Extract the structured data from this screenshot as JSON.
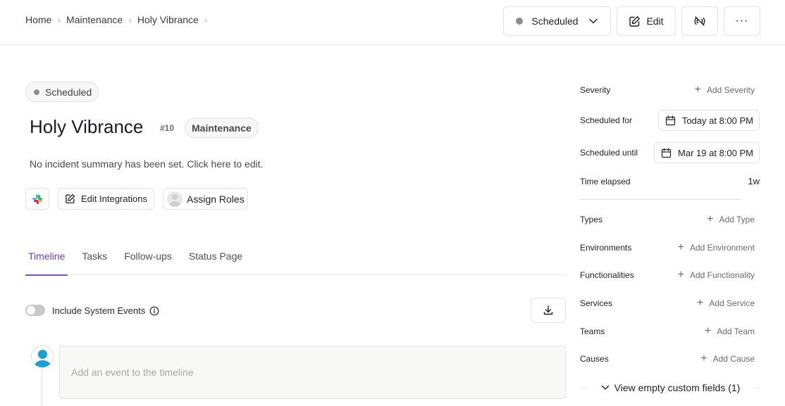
{
  "breadcrumb": [
    "Home",
    "Maintenance",
    "Holy Vibrance"
  ],
  "header": {
    "status_label": "Scheduled",
    "edit_label": "Edit",
    "more_label": "···"
  },
  "incident": {
    "status": "Scheduled",
    "title": "Holy Vibrance",
    "number": "#10",
    "type": "Maintenance",
    "summary": "No incident summary has been set. Click here to edit."
  },
  "actions": {
    "edit_integrations": "Edit Integrations",
    "assign_roles": "Assign Roles"
  },
  "tabs": [
    "Timeline",
    "Tasks",
    "Follow-ups",
    "Status Page"
  ],
  "timeline": {
    "toggle_label": "Include System Events",
    "event_placeholder": "Add an event to the timeline"
  },
  "details": {
    "severity": {
      "label": "Severity",
      "action": "Add Severity"
    },
    "scheduled_for": {
      "label": "Scheduled for",
      "value": "Today at 8:00 PM"
    },
    "scheduled_until": {
      "label": "Scheduled until",
      "value": "Mar 19 at 8:00 PM"
    },
    "time_elapsed": {
      "label": "Time elapsed",
      "value": "1w"
    },
    "fields": [
      {
        "label": "Types",
        "action": "Add Type"
      },
      {
        "label": "Environments",
        "action": "Add Environment"
      },
      {
        "label": "Functionalities",
        "action": "Add Functionality"
      },
      {
        "label": "Services",
        "action": "Add Service"
      },
      {
        "label": "Teams",
        "action": "Add Team"
      },
      {
        "label": "Causes",
        "action": "Add Cause"
      }
    ],
    "view_empty": "View empty custom fields (1)"
  },
  "colors": {
    "accent": "#7b4fd0",
    "status_dot": "#8d8d8f",
    "avatar": "#1a9ed4"
  }
}
